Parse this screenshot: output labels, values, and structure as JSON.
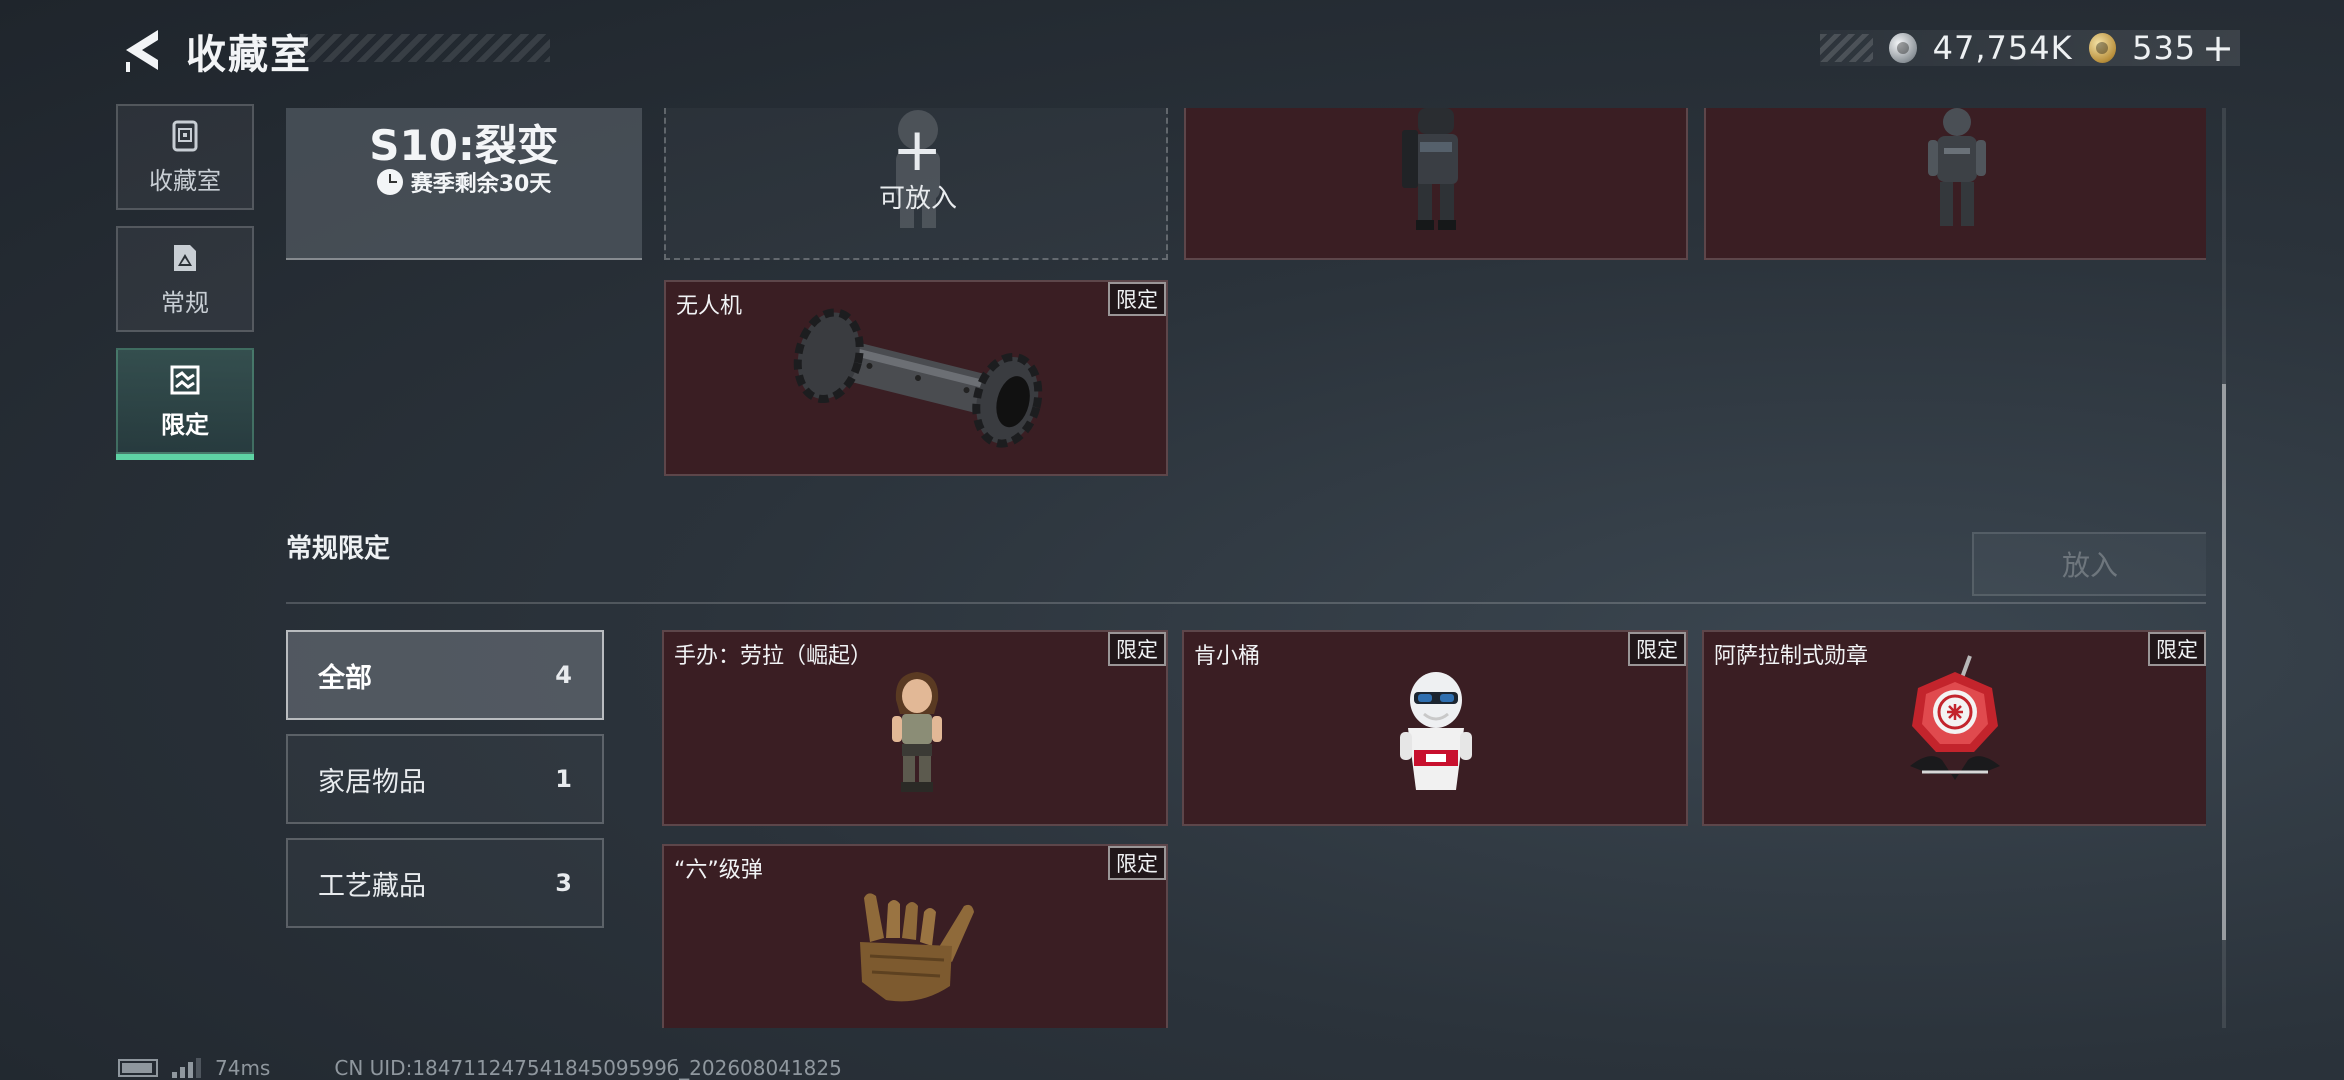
{
  "header": {
    "title": "收藏室",
    "currencies": [
      {
        "icon": "silver-coin-icon",
        "value": "47,754K"
      },
      {
        "icon": "gold-coin-icon",
        "value": "535"
      }
    ],
    "add_label": "+"
  },
  "sidenav": {
    "items": [
      {
        "label": "收藏室",
        "icon": "collection-room-icon",
        "active": false
      },
      {
        "label": "常规",
        "icon": "regular-icon",
        "active": false
      },
      {
        "label": "限定",
        "icon": "limited-icon",
        "active": true
      }
    ]
  },
  "season": {
    "name": "S10:裂变",
    "remaining": "赛季剩余30天",
    "add_slot_label": "可放入"
  },
  "top_cards": [
    {
      "name": "无人机",
      "badge": "限定",
      "icon": "drone-roller-icon"
    }
  ],
  "section": {
    "title": "常规限定",
    "place_button": "放入"
  },
  "filters": [
    {
      "label": "全部",
      "count": "4",
      "active": true
    },
    {
      "label": "家居物品",
      "count": "1",
      "active": false
    },
    {
      "label": "工艺藏品",
      "count": "3",
      "active": false
    }
  ],
  "items": [
    {
      "name": "手办：劳拉（崛起）",
      "badge": "限定",
      "icon": "lara-figure-icon"
    },
    {
      "name": "肯小桶",
      "badge": "限定",
      "icon": "bucket-figure-icon"
    },
    {
      "name": "阿萨拉制式勋章",
      "badge": "限定",
      "icon": "medal-icon"
    },
    {
      "name": "“六”级弹",
      "badge": "限定",
      "icon": "hand-gesture-icon"
    }
  ],
  "footer": {
    "ping": "74ms",
    "uid": "CN UID:18471124754184509599б_202608041825"
  }
}
